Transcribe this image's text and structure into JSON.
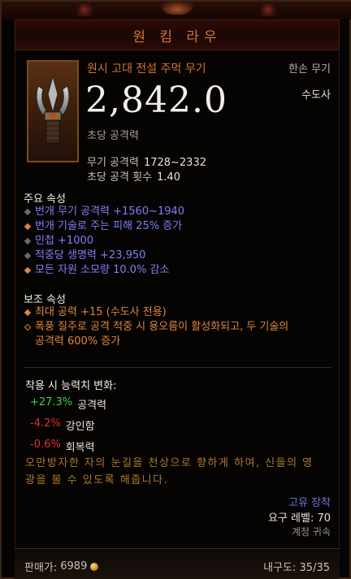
{
  "item": {
    "name": "원 킴 라우",
    "type": "원시 고대 전설 주먹 무기",
    "hand": "한손 무기",
    "class_requirement": "수도사",
    "dps": "2,842.0",
    "dps_label": "초당 공격력",
    "weapon_damage_label": "무기 공격력",
    "weapon_damage_value": "1728~2332",
    "attack_speed_label": "초당 공격 횟수",
    "attack_speed_value": "1.40",
    "icon": "fist-weapon-icon"
  },
  "primary": {
    "title": "주요 속성",
    "attributes": [
      {
        "text": "번개 무기 공격력 +1560~1940",
        "bullet": "normal"
      },
      {
        "text": "번개 기술로 주는 피해 25% 증가",
        "bullet": "legendary"
      },
      {
        "text": "민첩 +1000",
        "bullet": "normal"
      },
      {
        "text": "적중당 생명력 +23,950",
        "bullet": "normal"
      },
      {
        "text": "모든 자원 소모량 10.0% 감소",
        "bullet": "legendary"
      }
    ]
  },
  "secondary": {
    "title": "보조 속성",
    "attributes": [
      {
        "text": "최대 공력 +15 (수도사 전용)",
        "bullet": "legendary"
      },
      {
        "line1": "폭풍 질주로 공격 적중 시 용오름이 활성화되고, 두 기술의",
        "line2": "공격력 600% 증가",
        "bullet": "outline"
      }
    ]
  },
  "stat_changes": {
    "title": "착용 시 능력치 변화:",
    "items": [
      {
        "value": "+27.3%",
        "label": "공격력",
        "sign": "pos"
      },
      {
        "value": "-4.2%",
        "label": "강인함",
        "sign": "neg"
      },
      {
        "value": "-0.6%",
        "label": "회복력",
        "sign": "neg"
      }
    ]
  },
  "flavor": {
    "line1": "오만방자한 자의 눈길을 천상으로 향하게 하여, 신들의 영",
    "line2": "광을 볼 수 있도록 해줍니다."
  },
  "footer": {
    "unique_label": "고유 장착",
    "required_level": "요구 레벨: 70",
    "account_bound": "계정 귀속",
    "sell_label": "판매가:",
    "sell_value": "6989",
    "durability": "내구도: 35/35"
  },
  "colors": {
    "title": "#d8742e",
    "magic": "#7f7ff5",
    "legendary": "#e0843a",
    "positive": "#3ed23e",
    "negative": "#e03030",
    "flavor": "#b07a2a",
    "unique": "#6a7ad8"
  }
}
